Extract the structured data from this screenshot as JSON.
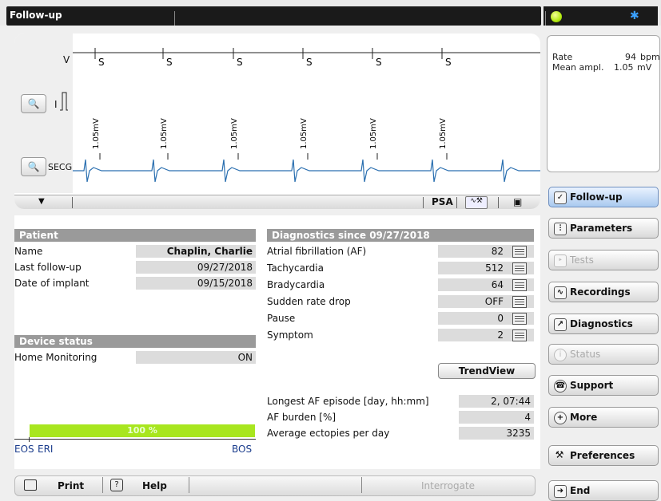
{
  "header": {
    "title": "Follow-up"
  },
  "ecg": {
    "channels": [
      "V",
      "I",
      "SECG"
    ],
    "markers": [
      "S",
      "S",
      "S",
      "S",
      "S",
      "S"
    ],
    "amplitudes": [
      "1.05mV",
      "1.05mV",
      "1.05mV",
      "1.05mV",
      "1.05mV",
      "1.05mV"
    ],
    "footer": {
      "psa_label": "PSA"
    }
  },
  "rate_box": {
    "rate_label": "Rate",
    "rate_value": "94",
    "rate_unit": "bpm",
    "ampl_label": "Mean ampl.",
    "ampl_value": "1.05",
    "ampl_unit": "mV"
  },
  "nav": {
    "follow_up": "Follow-up",
    "parameters": "Parameters",
    "tests": "Tests",
    "recordings": "Recordings",
    "diagnostics": "Diagnostics",
    "status": "Status",
    "support": "Support",
    "more": "More",
    "preferences": "Preferences",
    "end": "End"
  },
  "patient": {
    "header": "Patient",
    "rows": [
      {
        "label": "Name",
        "value": "Chaplin, Charlie"
      },
      {
        "label": "Last follow-up",
        "value": "09/27/2018"
      },
      {
        "label": "Date of implant",
        "value": "09/15/2018"
      }
    ]
  },
  "device_status": {
    "header": "Device status",
    "rows": [
      {
        "label": "Home Monitoring",
        "value": "ON"
      }
    ]
  },
  "diagnostics": {
    "header": "Diagnostics since 09/27/2018",
    "rows": [
      {
        "label": "Atrial fibrillation (AF)",
        "value": "82"
      },
      {
        "label": "Tachycardia",
        "value": "512"
      },
      {
        "label": "Bradycardia",
        "value": "64"
      },
      {
        "label": "Sudden rate drop",
        "value": "OFF"
      },
      {
        "label": "Pause",
        "value": "0"
      },
      {
        "label": "Symptom",
        "value": "2"
      }
    ],
    "trendview_label": "TrendView",
    "stats": [
      {
        "label": "Longest AF episode [day, hh:mm]",
        "value": "2, 07:44"
      },
      {
        "label": "AF burden [%]",
        "value": "4"
      },
      {
        "label": "Average ectopies per day",
        "value": "3235"
      }
    ]
  },
  "battery": {
    "level": "100 %",
    "fill_fraction": 1.0,
    "eos": "EOS",
    "eri": "ERI",
    "bos": "BOS",
    "color": "#a8e61f"
  },
  "toolbar": {
    "print": "Print",
    "help": "Help",
    "interrogate": "Interrogate"
  },
  "colors": {
    "ecg_trace": "#2a6fb0",
    "active_nav": "#a9c9ef",
    "status_led": "#b3ea10"
  }
}
